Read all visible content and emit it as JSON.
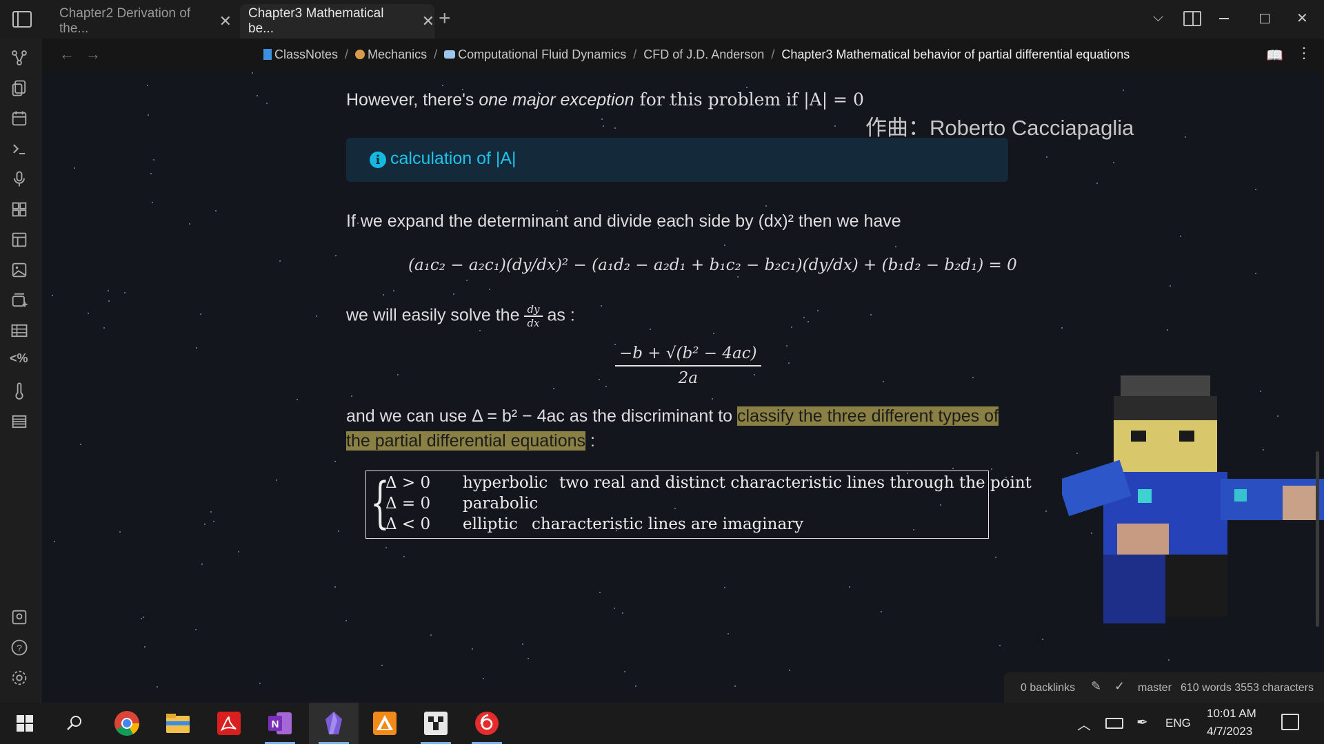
{
  "tabs": [
    {
      "label": "Chapter2 Derivation of the..."
    },
    {
      "label": "Chapter3 Mathematical be..."
    }
  ],
  "breadcrumb": [
    {
      "label": "ClassNotes"
    },
    {
      "label": "Mechanics"
    },
    {
      "label": "Computational Fluid Dynamics"
    },
    {
      "label": "CFD of J.D. Anderson"
    },
    {
      "label": "Chapter3 Mathematical behavior of partial differential equations"
    }
  ],
  "content": {
    "p1_pre": "However, there's ",
    "p1_em": "one major exception",
    "p1_post": " for this problem if |A| = 0",
    "callout_title": "calculation of |A|",
    "p2": "If we expand the determinant and divide each side by (dx)² then we have",
    "eq1": "(a₁c₂ − a₂c₁)(dy/dx)² − (a₁d₂ − a₂d₁ + b₁c₂ − b₂c₁)(dy/dx) + (b₁d₂ − b₂d₁) = 0",
    "p3_pre": "we will easily solve the",
    "p3_frac_num": "dy",
    "p3_frac_den": "dx",
    "p3_post": "as :",
    "eq2_num": "−b + √(b² − 4ac)",
    "eq2_den": "2a",
    "p4_pre": "and we can use Δ = b² − 4ac as the discriminant to ",
    "p4_hl1": "classify the three different types of",
    "p4_hl2": "the partial differential equations",
    "p4_post": " :",
    "cases": [
      {
        "cond": "Δ > 0",
        "type": "hyperbolic",
        "desc": "two real and distinct characteristic lines through the point"
      },
      {
        "cond": "Δ = 0",
        "type": "parabolic",
        "desc": ""
      },
      {
        "cond": "Δ < 0",
        "type": "elliptic",
        "desc": "characteristic lines are imaginary"
      }
    ],
    "composer": "作曲：Roberto Cacciapaglia"
  },
  "status": {
    "backlinks": "0 backlinks",
    "branch": "master",
    "counts": "610 words 3553 characters"
  },
  "taskbar": {
    "lang": "ENG",
    "time": "10:01 AM",
    "date": "4/7/2023"
  },
  "colors": {
    "accent": "#1cc3ea",
    "highlight": "#8a8044",
    "background": "#14161e"
  }
}
